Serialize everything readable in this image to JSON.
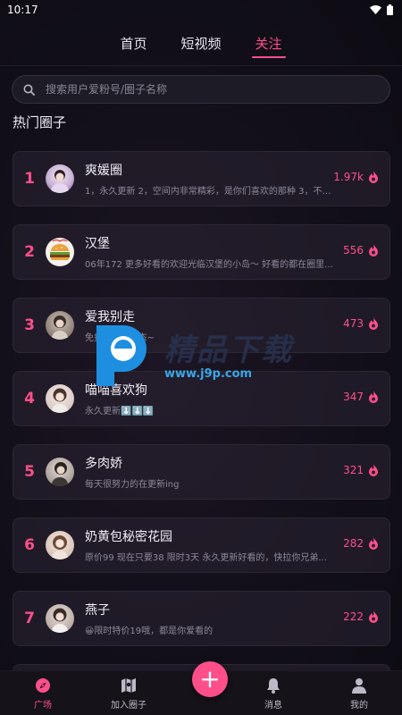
{
  "status_bar": {
    "time": "10:17"
  },
  "tabs": [
    {
      "label": "首页"
    },
    {
      "label": "短视频"
    },
    {
      "label": "关注"
    }
  ],
  "search": {
    "placeholder": "搜索用户爱粉号/圈子名称"
  },
  "section_title": "热门圈子",
  "circles": [
    {
      "rank": "1",
      "name": "爽媛圈",
      "desc": "1，永久更新 2，空间内非常精彩，是你们喜欢的那种 3，不要...",
      "heat": "1.97k"
    },
    {
      "rank": "2",
      "name": "汉堡",
      "desc": "06年172 更多好看的欢迎光临汉堡的小岛～ 好看的都在圈里...",
      "heat": "556"
    },
    {
      "rank": "3",
      "name": "爱我别走",
      "desc": "免费...生活动态~",
      "heat": "473"
    },
    {
      "rank": "4",
      "name": "喵喵喜欢狗",
      "desc": "永久更新⬇️⬇️⬇️",
      "heat": "347"
    },
    {
      "rank": "5",
      "name": "多肉娇",
      "desc": "每天很努力的在更新ing",
      "heat": "321"
    },
    {
      "rank": "6",
      "name": "奶黄包秘密花园",
      "desc": "原价99 现在只要38 限时3天 永久更新好看的，快拉你兄弟...",
      "heat": "282"
    },
    {
      "rank": "7",
      "name": "燕子",
      "desc": "😀限时特价19哦，都是你爱看的",
      "heat": "222"
    }
  ],
  "watermark": {
    "title": "精品下载",
    "url": "www.j9p.com"
  },
  "bottom_nav": [
    {
      "label": "广场",
      "icon": "compass-icon"
    },
    {
      "label": "加入圈子",
      "icon": "map-icon"
    },
    {
      "label": "消息",
      "icon": "bell-icon"
    },
    {
      "label": "我的",
      "icon": "user-icon"
    }
  ],
  "fab": {
    "label": "+"
  },
  "colors": {
    "accent": "#ff4f8b",
    "background": "#0f0d16",
    "card": "#282230"
  }
}
